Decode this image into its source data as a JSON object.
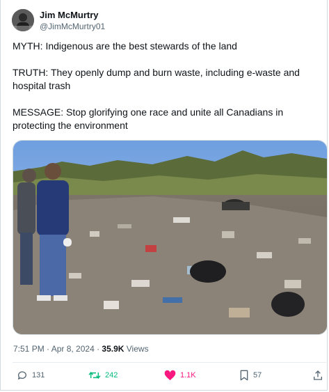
{
  "author": {
    "name": "Jim McMurtry",
    "handle": "@JimMcMurtry01"
  },
  "tweet": {
    "line1": "MYTH: Indigenous are the best stewards of the land",
    "line2": "TRUTH: They openly dump and burn waste, including e-waste and hospital trash",
    "line3": "MESSAGE: Stop glorifying one race and unite all Canadians in protecting the environment"
  },
  "meta": {
    "time": "7:51 PM · Apr 8, 2024 · ",
    "views_count": "35.9K",
    "views_label": " Views"
  },
  "actions": {
    "reply": {
      "count": "131",
      "icon": "reply-icon"
    },
    "repost": {
      "count": "242",
      "icon": "repost-icon",
      "color": "#00ba7c"
    },
    "like": {
      "count": "1.1K",
      "icon": "heart-icon",
      "color": "#f91880"
    },
    "bookmark": {
      "count": "57",
      "icon": "bookmark-icon"
    },
    "share": {
      "icon": "share-icon"
    }
  }
}
